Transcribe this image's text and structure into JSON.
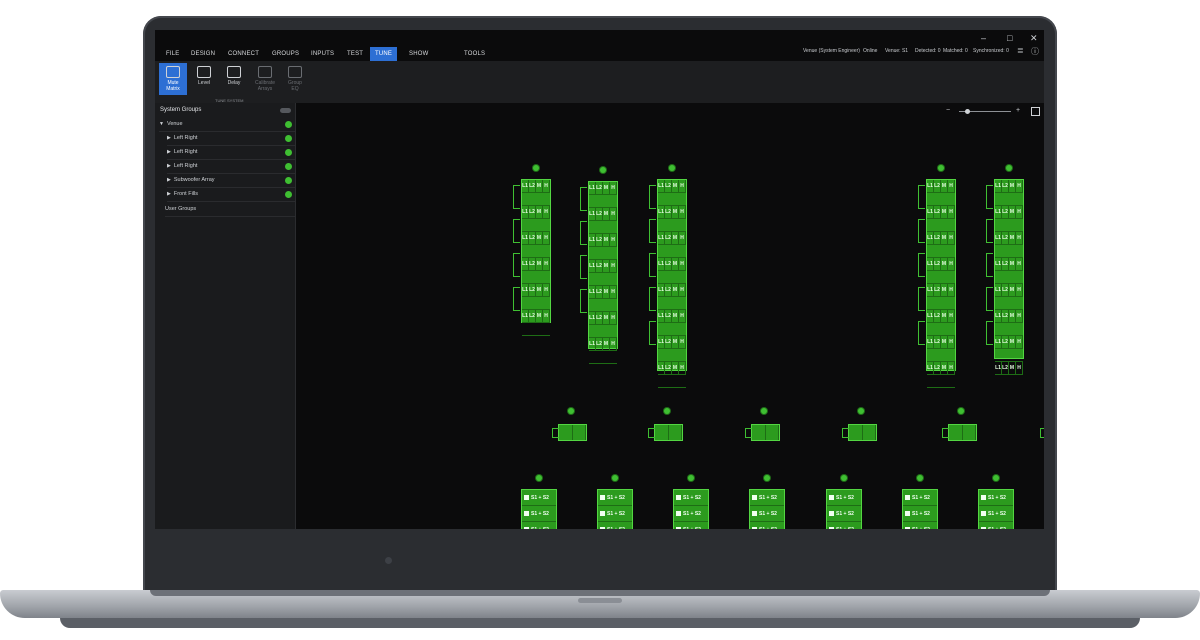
{
  "window": {
    "minimize": "–",
    "maximize": "□",
    "close": "✕"
  },
  "menu": [
    "FILE",
    "DESIGN",
    "CONNECT",
    "GROUPS",
    "INPUTS",
    "TEST",
    "TUNE",
    "SHOW",
    "TOOLS"
  ],
  "status": [
    "Venue (System Engineer)",
    "Online",
    "Venue: S1",
    "Detected: 0",
    "Matched: 0",
    "Synchronized: 0"
  ],
  "ribbon": {
    "buttons": [
      "Mute\nMatrix",
      "Level",
      "Delay",
      "Calibrate\nArrays",
      "Group\nEQ"
    ],
    "group_label": "TUNE SYSTEM"
  },
  "sidebar": {
    "title": "System Groups",
    "items": [
      "Venue",
      "Left Right",
      "Left Right",
      "Left Right",
      "Subwoofer Array",
      "Front Fills",
      "User Groups"
    ]
  },
  "zoom": {
    "minus": "−",
    "plus": "+"
  },
  "speaker": {
    "labels": [
      "L1",
      "L2",
      "M",
      "H"
    ],
    "fill_label": "S1 + S2"
  },
  "colors": {
    "accent": "#2d6fd4",
    "speaker_green": "#2c9b1e",
    "dot_green": "#3fbf32"
  }
}
